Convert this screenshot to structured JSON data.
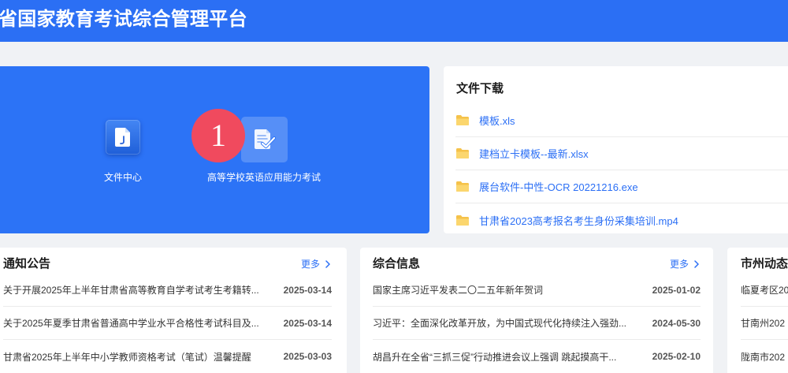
{
  "header": {
    "title": "省国家教育考试综合管理平台"
  },
  "quick_links": {
    "items": [
      {
        "label": "文件中心",
        "icon": "file-icon"
      },
      {
        "label": "高等学校英语应用能力考试",
        "icon": "document-check-icon"
      }
    ],
    "badge": "1"
  },
  "downloads": {
    "title": "文件下载",
    "items": [
      {
        "name": "模板.xls",
        "icon": "folder-icon"
      },
      {
        "name": "建档立卡模板--最新.xlsx",
        "icon": "folder-icon"
      },
      {
        "name": "展台软件-中性-OCR 20221216.exe",
        "icon": "folder-icon"
      },
      {
        "name": "甘肃省2023高考报名考生身份采集培训.mp4",
        "icon": "folder-icon"
      }
    ]
  },
  "notices": {
    "title": "通知公告",
    "more": "更多",
    "items": [
      {
        "title": "关于开展2025年上半年甘肃省高等教育自学考试考生考籍转...",
        "date": "2025-03-14"
      },
      {
        "title": "关于2025年夏季甘肃省普通高中学业水平合格性考试科目及...",
        "date": "2025-03-14"
      },
      {
        "title": "甘肃省2025年上半年中小学教师资格考试（笔试）温馨提醒",
        "date": "2025-03-03"
      }
    ]
  },
  "news": {
    "title": "综合信息",
    "more": "更多",
    "items": [
      {
        "title": "国家主席习近平发表二〇二五年新年贺词",
        "date": "2025-01-02"
      },
      {
        "title": "习近平：全面深化改革开放，为中国式现代化持续注入强劲...",
        "date": "2024-05-30"
      },
      {
        "title": "胡昌升在全省“三抓三促”行动推进会议上强调 跳起摸高干...",
        "date": "2025-02-10"
      }
    ]
  },
  "city_news": {
    "title": "市州动态",
    "items": [
      {
        "title": "临夏考区20"
      },
      {
        "title": "甘南州202"
      },
      {
        "title": "陇南市202"
      }
    ]
  },
  "colors": {
    "header_bg": "#2b6ff4",
    "panel_bg": "#2c73f6",
    "badge": "#f04a5e",
    "link": "#2b6ff5",
    "folder": "#f5c24a",
    "page_bg": "#f0f2f5"
  }
}
